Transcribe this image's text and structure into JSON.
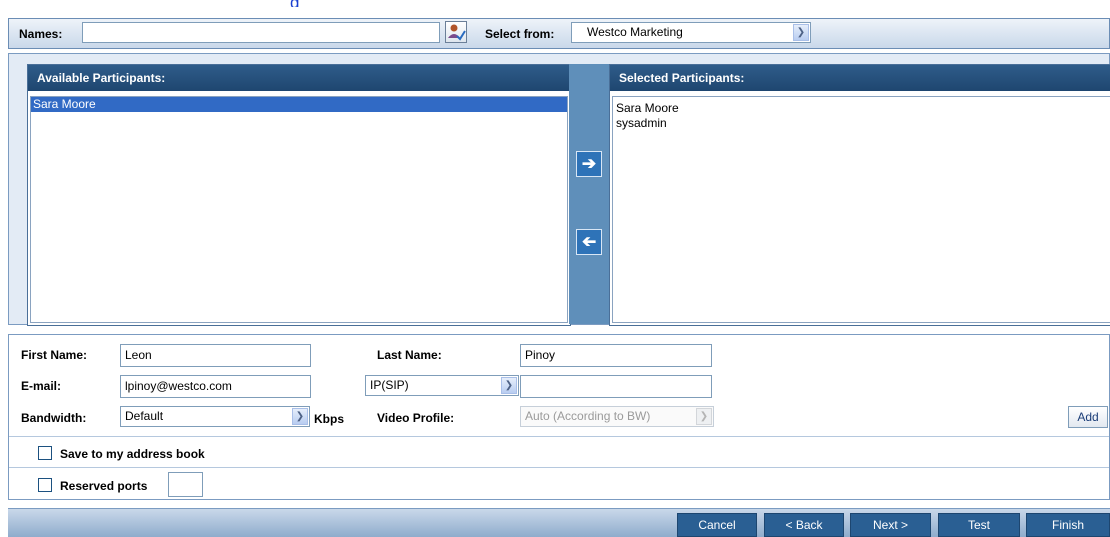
{
  "page_heading": "g",
  "topbar": {
    "names_label": "Names:",
    "names_value": "",
    "select_from_label": "Select from:",
    "select_from_value": "Westco Marketing"
  },
  "available": {
    "title": "Available Participants:",
    "items": [
      "Sara Moore"
    ]
  },
  "selected": {
    "title": "Selected Participants:",
    "items": [
      "Sara Moore",
      "sysadmin"
    ]
  },
  "form": {
    "first_name_label": "First Name:",
    "first_name_value": "Leon",
    "last_name_label": "Last Name:",
    "last_name_value": "Pinoy",
    "email_label": "E-mail:",
    "email_value": "lpinoy@westco.com",
    "protocol_value": "IP(SIP)",
    "address_value": "",
    "bandwidth_label": "Bandwidth:",
    "bandwidth_value": "Default",
    "kbps_label": "Kbps",
    "video_profile_label": "Video Profile:",
    "video_profile_value": "Auto (According to BW)",
    "add_label": "Add",
    "save_label": "Save to my address book",
    "reserved_label": "Reserved ports",
    "reserved_value": ""
  },
  "nav": {
    "cancel": "Cancel",
    "back": "< Back",
    "next": "Next >",
    "test": "Test",
    "finish": "Finish"
  },
  "icons": {
    "address_book": "address-book-icon",
    "move_right": "arrow-right-icon",
    "move_left": "arrow-left-icon",
    "dropdown": "chevron-down-icon"
  },
  "colors": {
    "header_blue": "#1e4670",
    "selection": "#316ac5",
    "nav_button": "#2a5f93"
  }
}
